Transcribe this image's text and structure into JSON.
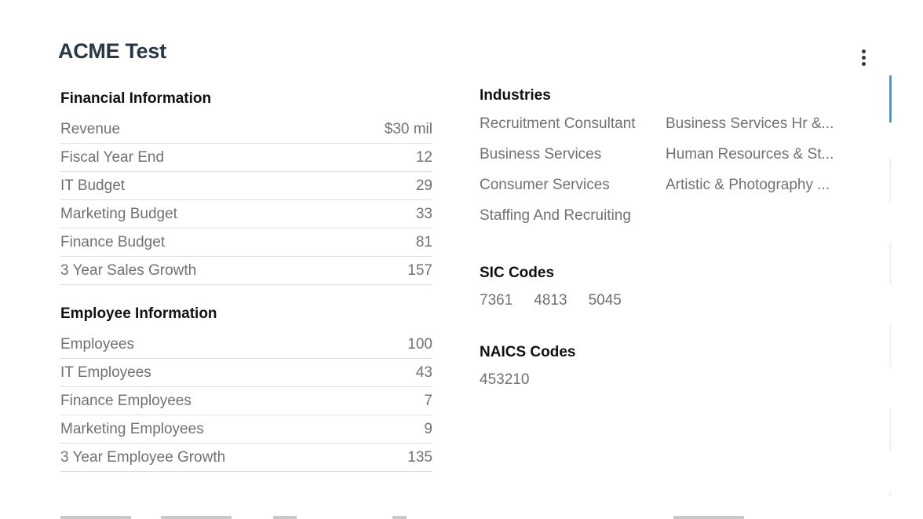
{
  "header": {
    "title": "ACME Test",
    "menu_icon": "more-vertical-icon"
  },
  "financial": {
    "heading": "Financial Information",
    "rows": [
      {
        "label": "Revenue",
        "value": "$30 mil"
      },
      {
        "label": "Fiscal Year End",
        "value": "12"
      },
      {
        "label": "IT Budget",
        "value": "29"
      },
      {
        "label": "Marketing Budget",
        "value": "33"
      },
      {
        "label": "Finance Budget",
        "value": "81"
      },
      {
        "label": "3 Year Sales Growth",
        "value": "157"
      }
    ]
  },
  "employee": {
    "heading": "Employee Information",
    "rows": [
      {
        "label": "Employees",
        "value": "100"
      },
      {
        "label": "IT Employees",
        "value": "43"
      },
      {
        "label": "Finance Employees",
        "value": "7"
      },
      {
        "label": "Marketing Employees",
        "value": "9"
      },
      {
        "label": "3 Year Employee Growth",
        "value": "135"
      }
    ]
  },
  "industries": {
    "heading": "Industries",
    "items": [
      "Recruitment Consultant",
      "Business Services Hr &...",
      "Business Services",
      "Human Resources & St...",
      "Consumer Services",
      "Artistic & Photography ...",
      "Staffing And Recruiting"
    ]
  },
  "sic": {
    "heading": "SIC Codes",
    "codes": [
      "7361",
      "4813",
      "5045"
    ]
  },
  "naics": {
    "heading": "NAICS Codes",
    "codes": [
      "453210"
    ]
  },
  "colors": {
    "title": "#283848",
    "label": "#717171",
    "accent": "#3c9fe0"
  }
}
